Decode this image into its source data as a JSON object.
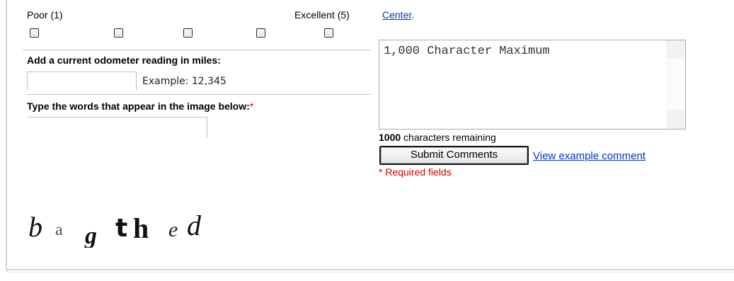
{
  "rating": {
    "low_label": "Poor (1)",
    "high_label": "Excellent (5)",
    "options": [
      "1",
      "2",
      "3",
      "4",
      "5"
    ]
  },
  "odometer": {
    "label": "Add a current odometer reading in miles:",
    "example": "Example: 12,345",
    "value": ""
  },
  "captcha": {
    "label": "Type the words that appear in the image below:",
    "required_mark": "*",
    "value": "",
    "image_text": "bagthed"
  },
  "help": {
    "link_text": "Center",
    "trailing": "."
  },
  "comments": {
    "placeholder": "1,000 Character Maximum",
    "remaining_count": "1000",
    "remaining_suffix": " characters remaining",
    "submit_label": "Submit Comments",
    "example_link": "View example comment",
    "required_note": "* Required fields"
  },
  "colors": {
    "link": "#0033cc",
    "required": "#cc0000",
    "border": "#cfd3dc"
  }
}
